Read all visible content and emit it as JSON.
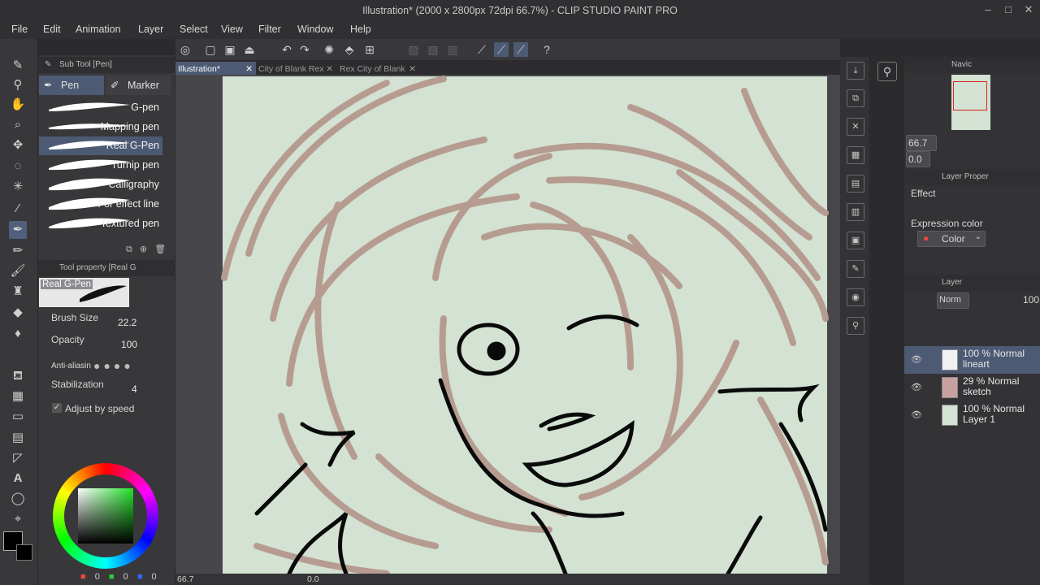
{
  "window": {
    "title": "Illustration* (2000 x 2800px 72dpi 66.7%)  - CLIP STUDIO PAINT PRO",
    "minimize_glyph": "–",
    "maximize_glyph": "□",
    "close_glyph": "✕"
  },
  "menu": [
    "File",
    "Edit",
    "Animation",
    "Layer",
    "Select",
    "View",
    "Filter",
    "Window",
    "Help"
  ],
  "subtool_panel": {
    "title": "Sub Tool [Pen]",
    "tab_pen": "Pen",
    "tab_marker": "Marker",
    "brushes": [
      "G-pen",
      "Mapping pen",
      "Real G-Pen",
      "Turnip pen",
      "Calligraphy",
      "For effect line",
      "Textured pen"
    ]
  },
  "tool_property": {
    "title": "Tool property [Real G",
    "preview_label": "Real G-Pen",
    "brush_size_label": "Brush Size",
    "brush_size_value": "22.2",
    "opacity_label": "Opacity",
    "opacity_value": "100",
    "antialias_label": "Anti-aliasin",
    "stabilization_label": "Stabilization",
    "stabilization_value": "4",
    "adjust_label": "Adjust by speed",
    "adjust_checked": "✓"
  },
  "color_values": {
    "r": "0",
    "g": "0",
    "b": "0"
  },
  "doc_tabs": [
    "Illustration*",
    "City of Blank Rex",
    "Rex City of Blank"
  ],
  "status": {
    "zoom": "66.7",
    "angle": "0.0"
  },
  "navigator": {
    "title": "Navic",
    "zoom": "66.7",
    "angle": "0.0"
  },
  "layer_property": {
    "title": "Layer Proper",
    "effect_label": "Effect",
    "expression_label": "Expression color",
    "color_value": "Color"
  },
  "layer_panel": {
    "title": "Layer",
    "blend": "Norm",
    "opacity": "100",
    "layers": [
      {
        "line1": "100 % Normal",
        "line2": "lineart",
        "thumb_color": "#f2f2f2",
        "selected": true
      },
      {
        "line1": "29 % Normal",
        "line2": "sketch",
        "thumb_color": "#c9a0a0",
        "selected": false
      },
      {
        "line1": "100 % Normal",
        "line2": "Layer 1",
        "thumb_color": "#d3e2d2",
        "selected": false
      }
    ]
  },
  "colors": {
    "accent": "#4d5a73",
    "canvas_bg": "#d3e2d2",
    "sketch_stroke": "#b69c90",
    "line_stroke": "#0a0a0a"
  }
}
